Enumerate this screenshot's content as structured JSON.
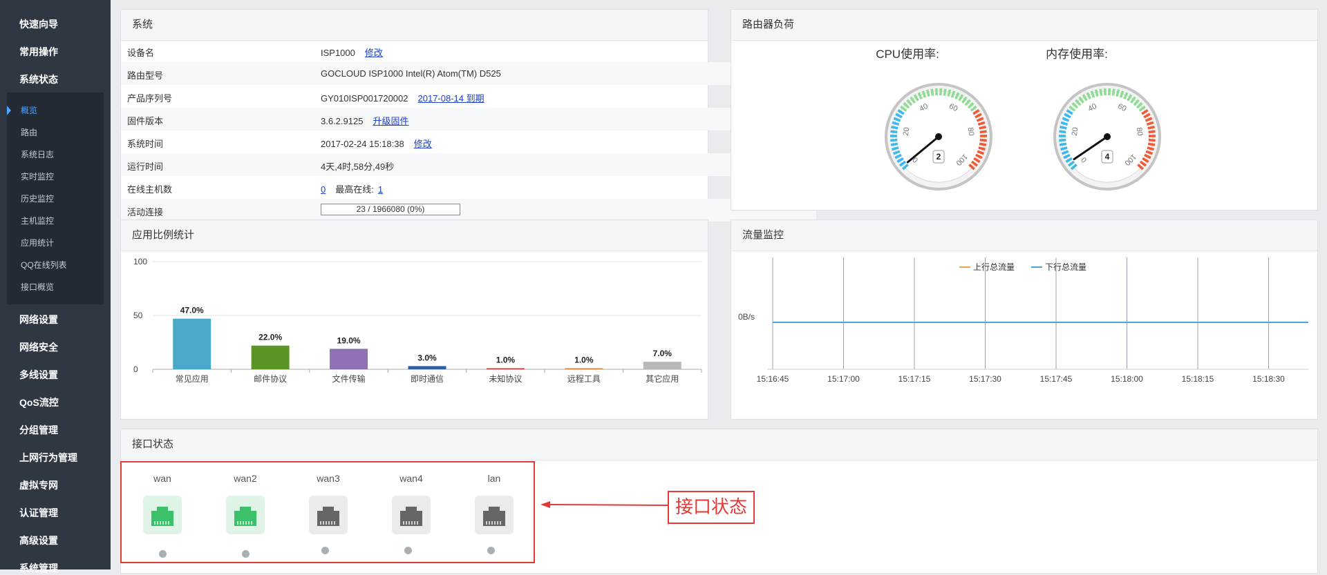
{
  "sidebar": {
    "items_top": [
      "快速向导",
      "常用操作",
      "系统状态"
    ],
    "sub_items": [
      "概览",
      "路由",
      "系统日志",
      "实时监控",
      "历史监控",
      "主机监控",
      "应用统计",
      "QQ在线列表",
      "接口概览"
    ],
    "items_bottom": [
      "网络设置",
      "网络安全",
      "多线设置",
      "QoS流控",
      "分组管理",
      "上网行为管理",
      "虚拟专网",
      "认证管理",
      "高级设置",
      "系统管理"
    ],
    "active_sub": "概览"
  },
  "system": {
    "title": "系统",
    "rows": [
      {
        "label": "设备名",
        "value": "ISP1000",
        "link": "修改"
      },
      {
        "label": "路由型号",
        "value": "GOCLOUD ISP1000 Intel(R) Atom(TM) D525"
      },
      {
        "label": "产品序列号",
        "value": "GY010ISP001720002",
        "link": "2017-08-14 到期"
      },
      {
        "label": "固件版本",
        "value": "3.6.2.9125",
        "link": "升级固件"
      },
      {
        "label": "系统时间",
        "value": "2017-02-24 15:18:38",
        "link": "修改"
      },
      {
        "label": "运行时间",
        "value": "4天,4时,58分,49秒"
      },
      {
        "label": "在线主机数",
        "value_link": "0",
        "extra_label": "最高在线:",
        "extra_link": "1"
      },
      {
        "label": "活动连接",
        "progress_text": "23 / 1966080 (0%)",
        "progress_fraction": 0
      }
    ]
  },
  "router_load": {
    "title": "路由器负荷",
    "gauges": [
      {
        "title": "CPU使用率:",
        "value": 2,
        "max": 100,
        "ticks": [
          "0",
          "20",
          "40",
          "60",
          "80",
          "100"
        ]
      },
      {
        "title": "内存使用率:",
        "value": 4,
        "max": 100,
        "ticks": [
          "0",
          "20",
          "40",
          "60",
          "80",
          "100"
        ]
      }
    ]
  },
  "app_stats": {
    "title": "应用比例统计",
    "chart_data": {
      "type": "bar",
      "categories": [
        "常见应用",
        "邮件协议",
        "文件传输",
        "即时通信",
        "未知协议",
        "远程工具",
        "其它应用"
      ],
      "values": [
        47.0,
        22.0,
        19.0,
        3.0,
        1.0,
        1.0,
        7.0
      ],
      "labels": [
        "47.0%",
        "22.0%",
        "19.0%",
        "3.0%",
        "1.0%",
        "1.0%",
        "7.0%"
      ],
      "colors": [
        "#4aa8c9",
        "#5d9426",
        "#8e70b4",
        "#2e5fa8",
        "#d43c3c",
        "#e0883a",
        "#b9b9b9"
      ],
      "yticks": [
        "0",
        "50",
        "100"
      ],
      "ylim": [
        0,
        100
      ],
      "grid": true
    }
  },
  "traffic": {
    "title": "流量监控",
    "chart_data": {
      "type": "line",
      "x": [
        "15:16:45",
        "15:17:00",
        "15:17:15",
        "15:17:30",
        "15:17:45",
        "15:18:00",
        "15:18:15",
        "15:18:30"
      ],
      "series": [
        {
          "name": "上行总流量",
          "color": "#f0a04b",
          "values": [
            0,
            0,
            0,
            0,
            0,
            0,
            0,
            0
          ]
        },
        {
          "name": "下行总流量",
          "color": "#4aa3df",
          "values": [
            0,
            0,
            0,
            0,
            0,
            0,
            0,
            0
          ]
        }
      ],
      "ytick": "0B/s",
      "legend": "top-center"
    }
  },
  "interfaces": {
    "title": "接口状态",
    "ports": [
      {
        "name": "wan",
        "status": "up"
      },
      {
        "name": "wan2",
        "status": "up"
      },
      {
        "name": "wan3",
        "status": "down"
      },
      {
        "name": "wan4",
        "status": "down"
      },
      {
        "name": "lan",
        "status": "down"
      }
    ],
    "annotation": "接口状态",
    "colors": {
      "up": "#3cc06a",
      "down": "#666666",
      "up_bg": "#dff3e6",
      "down_bg": "#ebebeb"
    }
  }
}
